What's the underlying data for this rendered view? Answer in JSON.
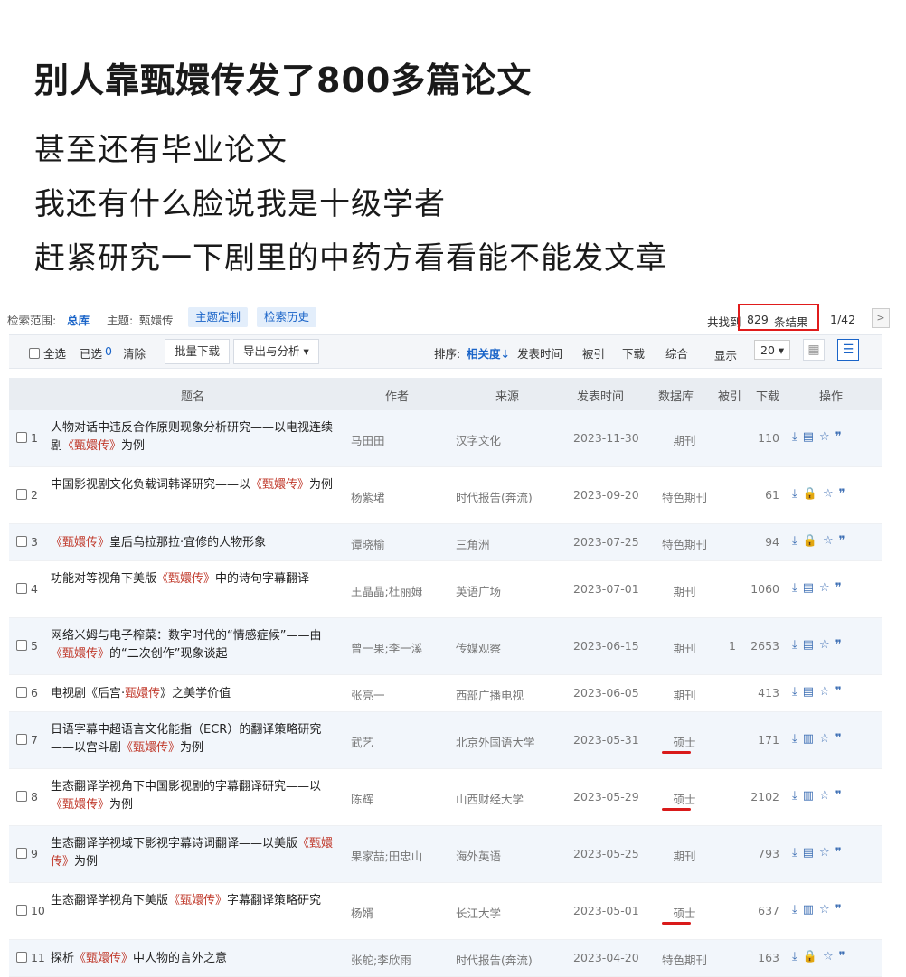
{
  "headline": "别人靠甄嬛传发了800多篇论文",
  "sublines": [
    "甚至还有毕业论文",
    "我还有什么脸说我是十级学者",
    "赶紧研究一下剧里的中药方看看能不能发文章"
  ],
  "scope": {
    "label": "检索范围:",
    "value": "总库",
    "topic_label": "主题:",
    "topic_value": "甄嬛传",
    "btn_custom": "主题定制",
    "btn_history": "检索历史"
  },
  "results": {
    "prefix": "共找到",
    "count": "829",
    "suffix": "条结果",
    "page": "1/42",
    "next": ">"
  },
  "toolbar": {
    "select_all": "全选",
    "selected": "已选",
    "selected_count": "0",
    "clear": "清除",
    "batch_download": "批量下载",
    "export": "导出与分析 ▾",
    "sort_label": "排序:",
    "sort_relevance": "相关度↓",
    "sort_date": "发表时间",
    "sort_cited": "被引",
    "sort_download": "下载",
    "sort_overall": "综合",
    "display_label": "显示",
    "page_size": "20 ▾"
  },
  "headers": {
    "title": "题名",
    "author": "作者",
    "source": "来源",
    "date": "发表时间",
    "db": "数据库",
    "cited": "被引",
    "download": "下载",
    "ops": "操作"
  },
  "rows": [
    {
      "idx": "1",
      "title_a": "人物对话中违反合作原则现象分析研究——以电视连续剧",
      "hl": "《甄嬛传》",
      "title_b": "为例",
      "author": "马田田",
      "source": "汉字文化",
      "date": "2023-11-30",
      "db": "期刊",
      "cited": "",
      "download": "110"
    },
    {
      "idx": "2",
      "title_a": "中国影视剧文化负载词韩译研究——以",
      "hl": "《甄嬛传》",
      "title_b": "为例",
      "author": "杨紫珺",
      "source": "时代报告(奔流)",
      "date": "2023-09-20",
      "db": "特色期刊",
      "cited": "",
      "download": "61"
    },
    {
      "idx": "3",
      "title_a": "",
      "hl": "《甄嬛传》",
      "title_b": "皇后乌拉那拉·宜修的人物形象",
      "author": "谭晓榆",
      "source": "三角洲",
      "date": "2023-07-25",
      "db": "特色期刊",
      "cited": "",
      "download": "94"
    },
    {
      "idx": "4",
      "title_a": "功能对等视角下美版",
      "hl": "《甄嬛传》",
      "title_b": "中的诗句字幕翻译",
      "author": "王晶晶;杜丽姆",
      "source": "英语广场",
      "date": "2023-07-01",
      "db": "期刊",
      "cited": "",
      "download": "1060"
    },
    {
      "idx": "5",
      "title_a": "网络米姆与电子榨菜：数字时代的“情感症候”——由",
      "hl": "《甄嬛传》",
      "title_b": "的“二次创作”现象谈起",
      "author": "曾一果;李一溪",
      "source": "传媒观察",
      "date": "2023-06-15",
      "db": "期刊",
      "cited": "1",
      "download": "2653"
    },
    {
      "idx": "6",
      "title_a": "电视剧《后宫·",
      "hl": "甄嬛传",
      "title_b": "》之美学价值",
      "author": "张亮一",
      "source": "西部广播电视",
      "date": "2023-06-05",
      "db": "期刊",
      "cited": "",
      "download": "413"
    },
    {
      "idx": "7",
      "title_a": "日语字幕中超语言文化能指（ECR）的翻译策略研究——以宫斗剧",
      "hl": "《甄嬛传》",
      "title_b": "为例",
      "author": "武艺",
      "source": "北京外国语大学",
      "date": "2023-05-31",
      "db": "硕士",
      "cited": "",
      "download": "171"
    },
    {
      "idx": "8",
      "title_a": "生态翻译学视角下中国影视剧的字幕翻译研究——以",
      "hl": "《甄嬛传》",
      "title_b": "为例",
      "author": "陈辉",
      "source": "山西财经大学",
      "date": "2023-05-29",
      "db": "硕士",
      "cited": "",
      "download": "2102"
    },
    {
      "idx": "9",
      "title_a": "生态翻译学视域下影视字幕诗词翻译——以美版",
      "hl": "《甄嬛传》",
      "title_b": "为例",
      "author": "果家喆;田忠山",
      "source": "海外英语",
      "date": "2023-05-25",
      "db": "期刊",
      "cited": "",
      "download": "793"
    },
    {
      "idx": "10",
      "title_a": "生态翻译学视角下美版",
      "hl": "《甄嬛传》",
      "title_b": "字幕翻译策略研究",
      "author": "杨婿",
      "source": "长江大学",
      "date": "2023-05-01",
      "db": "硕士",
      "cited": "",
      "download": "637"
    },
    {
      "idx": "11",
      "title_a": "探析",
      "hl": "《甄嬛传》",
      "title_b": "中人物的言外之意",
      "author": "张舵;李欣雨",
      "source": "时代报告(奔流)",
      "date": "2023-04-20",
      "db": "特色期刊",
      "cited": "",
      "download": "163"
    }
  ],
  "colors": {
    "accent": "#1a64c8",
    "highlight": "#c0392b",
    "annotation": "#d91a1a"
  }
}
